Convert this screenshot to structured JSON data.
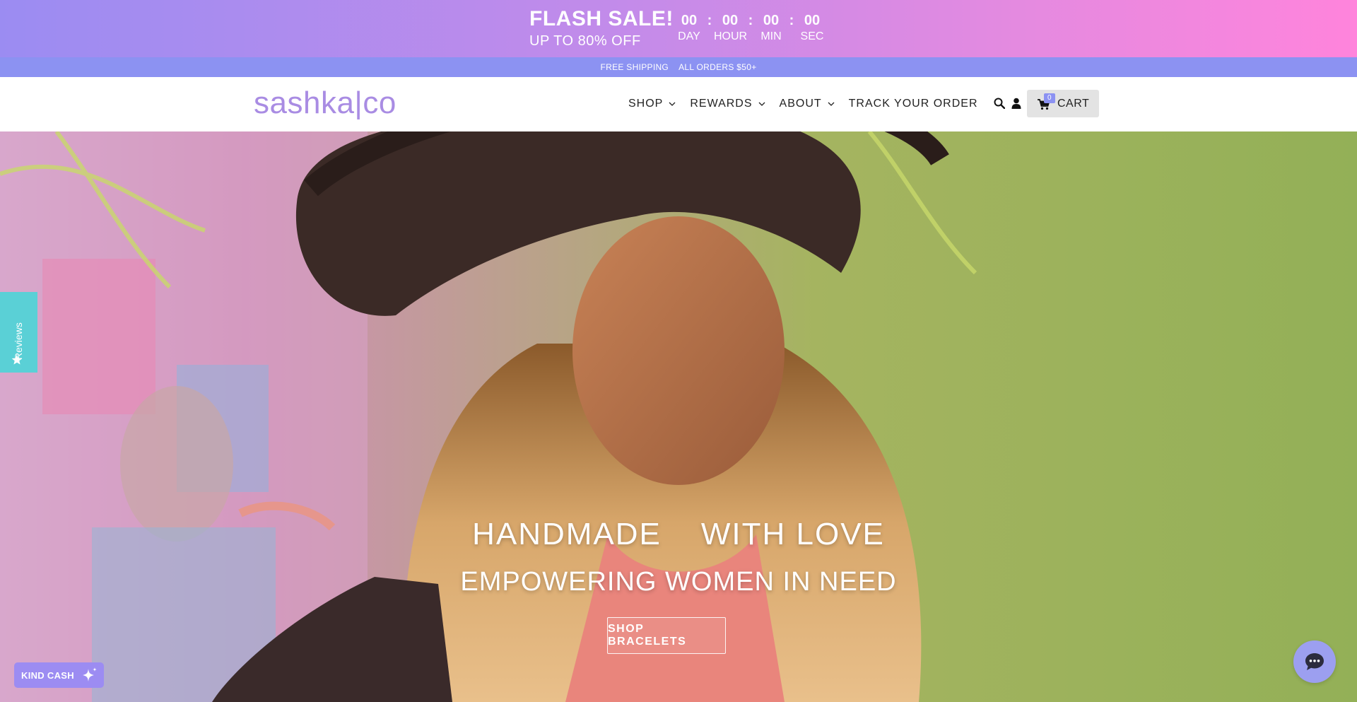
{
  "flash_bar": {
    "title": "FLASH SALE!",
    "subtitle": "UP TO 80% OFF",
    "countdown": [
      {
        "value": "00",
        "label": "DAY"
      },
      {
        "value": "00",
        "label": "HOUR"
      },
      {
        "value": "00",
        "label": "MIN"
      },
      {
        "value": "00",
        "label": "SEC"
      }
    ],
    "separator": ":",
    "gradient_colors": [
      "#9b8cf2",
      "#ff84dc"
    ]
  },
  "shipping_bar": {
    "left_text": "FREE SHIPPING",
    "right_text": "ALL ORDERS $50+",
    "bg_color": "#8c92f2"
  },
  "header": {
    "logo_text": "sashka|co",
    "logo_color": "#a98ce3",
    "nav": [
      {
        "label": "SHOP",
        "has_dropdown": true
      },
      {
        "label": "REWARDS",
        "has_dropdown": true
      },
      {
        "label": "ABOUT",
        "has_dropdown": true
      },
      {
        "label": "TRACK YOUR ORDER",
        "has_dropdown": false
      }
    ],
    "icons": [
      "search-icon",
      "account-icon"
    ],
    "cart": {
      "label": "CART",
      "count": "0",
      "icon": "cart-icon"
    }
  },
  "hero": {
    "line1_a": "HANDMADE",
    "line1_b": "WITH LOVE",
    "line2": "EMPOWERING WOMEN IN NEED",
    "button_label": "SHOP BRACELETS"
  },
  "widgets": {
    "reviews_label": "Reviews",
    "reviews_color": "#5ad0d6",
    "kind_cash_label": "KIND CASH",
    "kind_cash_color": "#9c8cf2",
    "chat_icon": "chat-bubble-icon"
  }
}
